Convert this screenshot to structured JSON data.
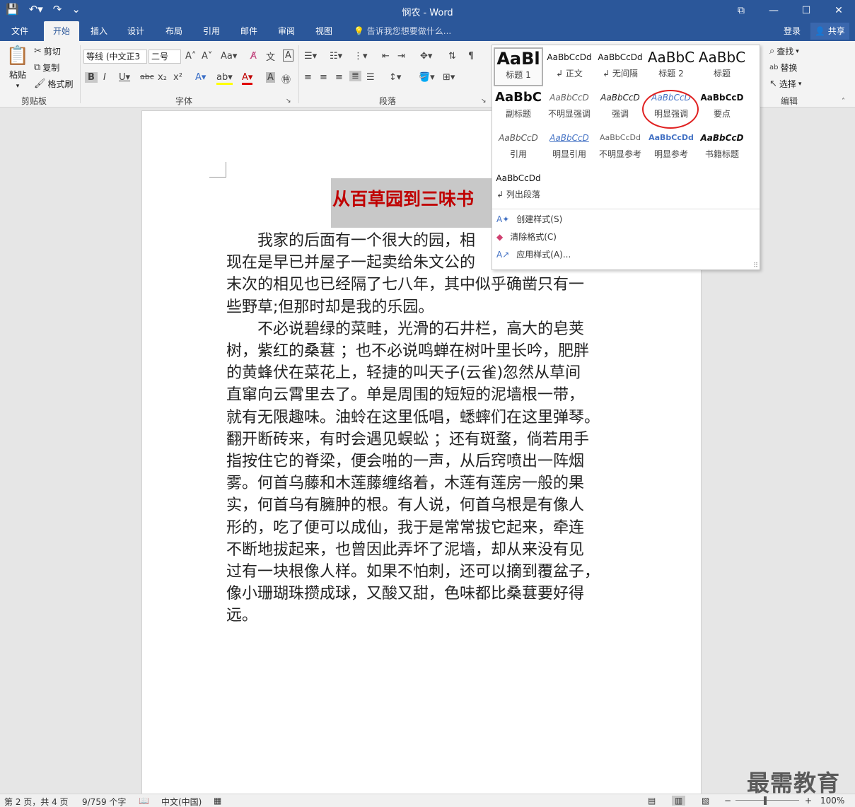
{
  "titlebar": {
    "title": "悯农 - Word",
    "save_icon": "save-icon",
    "undo_icon": "undo-icon",
    "redo_icon": "redo-icon",
    "customize_icon": "customize-icon",
    "ribbon_display_icon": "ribbon-display-icon",
    "minimize": "—",
    "maximize": "☐",
    "close": "✕"
  },
  "tabs": [
    {
      "label": "文件"
    },
    {
      "label": "开始"
    },
    {
      "label": "插入"
    },
    {
      "label": "设计"
    },
    {
      "label": "布局"
    },
    {
      "label": "引用"
    },
    {
      "label": "邮件"
    },
    {
      "label": "审阅"
    },
    {
      "label": "视图"
    }
  ],
  "tellme": "告诉我您想要做什么...",
  "login": "登录",
  "share": "共享",
  "clipboard": {
    "paste": "粘贴",
    "cut": "剪切",
    "copy": "复制",
    "format_painter": "格式刷",
    "group": "剪贴板"
  },
  "font": {
    "name": "等线 (中文正文)",
    "name_display": "等线 (中文正3",
    "size": "二号",
    "group": "字体"
  },
  "paragraph": {
    "group": "段落"
  },
  "editing": {
    "find": "查找",
    "replace": "替换",
    "select": "选择",
    "group": "编辑"
  },
  "styles_gallery": {
    "items": [
      {
        "preview": "AaBl",
        "name": "标题 1"
      },
      {
        "preview": "AaBbCcDd",
        "name": "↲ 正文"
      },
      {
        "preview": "AaBbCcDd",
        "name": "↲ 无间隔"
      },
      {
        "preview": "AaBbC",
        "name": "标题 2"
      },
      {
        "preview": "AaBbC",
        "name": "标题"
      },
      {
        "preview": "AaBbC",
        "name": "副标题"
      },
      {
        "preview": "AaBbCcD",
        "name": "不明显强调"
      },
      {
        "preview": "AaBbCcD",
        "name": "强调"
      },
      {
        "preview": "AaBbCcD",
        "name": "明显强调"
      },
      {
        "preview": "AaBbCcD",
        "name": "要点"
      },
      {
        "preview": "AaBbCcD",
        "name": "引用"
      },
      {
        "preview": "AaBbCcD",
        "name": "明显引用"
      },
      {
        "preview": "AaBbCcDd",
        "name": "不明显参考"
      },
      {
        "preview": "AaBbCcDd",
        "name": "明显参考"
      },
      {
        "preview": "AaBbCcD",
        "name": "书籍标题"
      },
      {
        "preview": "AaBbCcDd",
        "name": "↲ 列出段落"
      }
    ],
    "create_style": "创建样式(S)",
    "clear_format": "清除格式(C)",
    "apply_style": "应用样式(A)..."
  },
  "document": {
    "title": "从百草园到三味书",
    "lines": [
      "　　我家的后面有一个很大的园，相",
      "现在是早已并屋子一起卖给朱文公的",
      "末次的相见也已经隔了七八年，其中似乎确凿只有一",
      "些野草;但那时却是我的乐园。",
      "　　不必说碧绿的菜畦，光滑的石井栏，高大的皂荚",
      "树，紫红的桑葚 ；也不必说鸣蝉在树叶里长吟，肥胖",
      "的黄蜂伏在菜花上，轻捷的叫天子(云雀)忽然从草间",
      "直窜向云霄里去了。单是周围的短短的泥墙根一带，",
      "就有无限趣味。油蛉在这里低唱，蟋蟀们在这里弹琴。",
      "翻开断砖来，有时会遇见蜈蚣 ；还有斑蝥，倘若用手",
      "指按住它的脊梁，便会啪的一声，从后窍喷出一阵烟",
      "雾。何首乌藤和木莲藤缠络着，木莲有莲房一般的果",
      "实，何首乌有臃肿的根。有人说，何首乌根是有像人",
      "形的，吃了便可以成仙，我于是常常拔它起来，牵连",
      "不断地拔起来，也曾因此弄坏了泥墙，却从来没有见",
      "过有一块根像人样。如果不怕刺，还可以摘到覆盆子，",
      "像小珊瑚珠攒成球，又酸又甜，色味都比桑葚要好得",
      "远。"
    ]
  },
  "status": {
    "page": "第 2 页，共 4 页",
    "words": "9/759 个字",
    "language": "中文(中国)",
    "zoom": "100%"
  },
  "watermark": "最需教育",
  "colors": {
    "brand": "#2b579a",
    "title_red": "#c00000",
    "highlight_circle": "#e02020"
  }
}
